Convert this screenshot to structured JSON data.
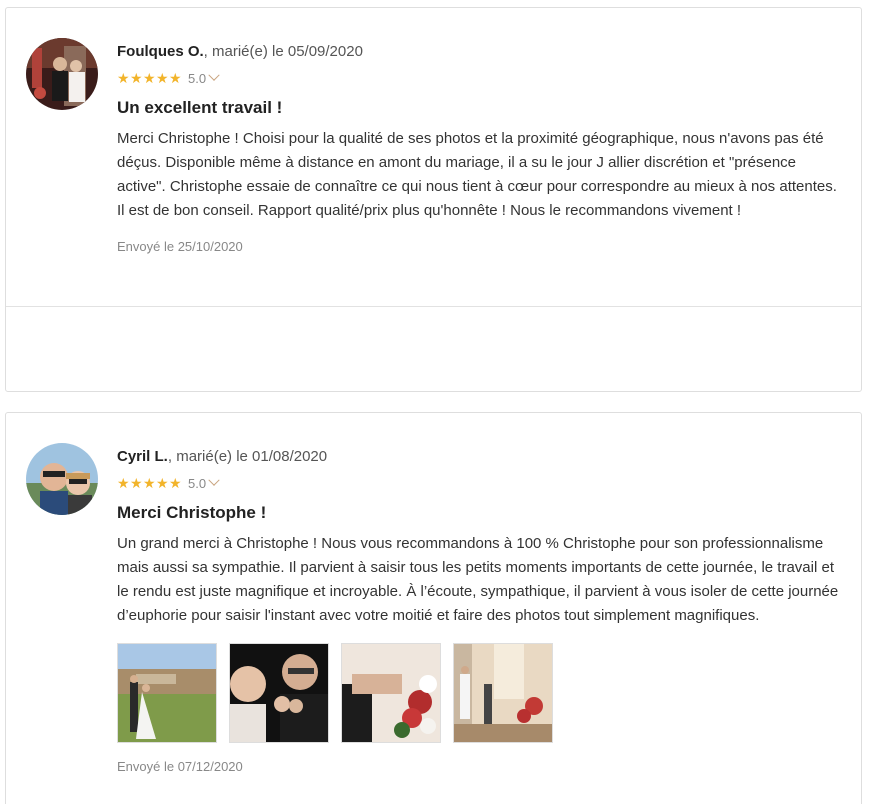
{
  "reviews": [
    {
      "author": "Foulques O.",
      "married": ", marié(e) le 05/09/2020",
      "score": "5.0",
      "title": "Un excellent travail !",
      "body": "Merci Christophe ! Choisi pour la qualité de ses photos et la proximité géographique, nous n'avons pas été déçus. Disponible même à distance en amont du mariage, il a su le jour J allier discrétion et \"présence active\". Christophe essaie de connaître ce qui nous tient à cœur pour correspondre au mieux à nos attentes. Il est de bon conseil. Rapport qualité/prix plus qu'honnête ! Nous le recommandons vivement !",
      "sent": "Envoyé le 25/10/2020"
    },
    {
      "author": "Cyril L.",
      "married": ", marié(e) le 01/08/2020",
      "score": "5.0",
      "title": "Merci Christophe !",
      "body": "Un grand merci à Christophe ! Nous vous recommandons à 100 % Christophe pour son professionnalisme mais aussi sa sympathie. Il parvient à saisir tous les petits moments importants de cette journée, le travail et le rendu est juste magnifique et incroyable. À l’écoute, sympathique, il parvient à vous isoler de cette journée d’euphorie pour saisir l'instant avec votre moitié et faire des photos tout simplement magnifiques.",
      "sent": "Envoyé le 07/12/2020"
    }
  ],
  "colors": {
    "star": "#f2b42b",
    "border": "#dedede",
    "muted": "#888888"
  },
  "icons": {
    "star": "star-icon",
    "chevron": "chevron-down-icon"
  }
}
